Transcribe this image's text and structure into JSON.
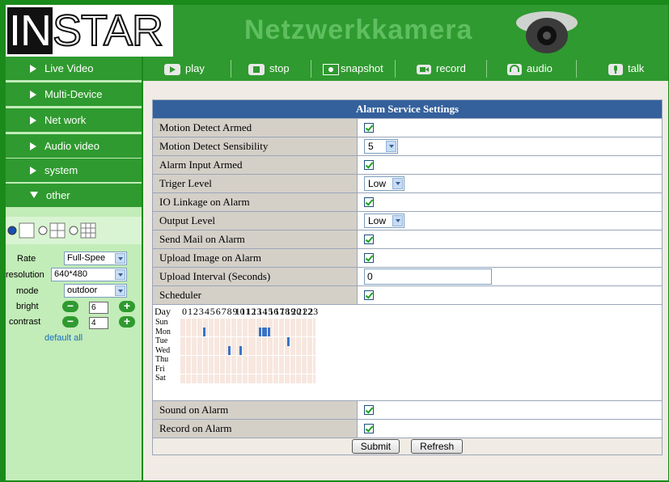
{
  "header": {
    "logo_text": "INSTAR",
    "logo_part1": "IN",
    "logo_part2": "STAR",
    "title": "Netzwerkkamera"
  },
  "sidebar": {
    "items": [
      {
        "label": "Live Video",
        "expanded": false
      },
      {
        "label": "Multi-Device",
        "expanded": false
      },
      {
        "label": "Net work",
        "expanded": false
      },
      {
        "label": "Audio video",
        "expanded": false
      },
      {
        "label": "system",
        "expanded": false
      },
      {
        "label": "other",
        "expanded": true
      }
    ],
    "controls": {
      "rate_label": "Rate",
      "rate_value": "Full-Spee",
      "resolution_label": "resolution",
      "resolution_value": "640*480",
      "mode_label": "mode",
      "mode_value": "outdoor",
      "bright_label": "bright",
      "bright_value": "6",
      "contrast_label": "contrast",
      "contrast_value": "4",
      "minus": "−",
      "plus": "+",
      "default_all": "default all"
    }
  },
  "toolbar": [
    {
      "label": "play",
      "icon": "play-icon"
    },
    {
      "label": "stop",
      "icon": "stop-icon"
    },
    {
      "label": "snapshot",
      "icon": "camera-icon"
    },
    {
      "label": "record",
      "icon": "video-camera-icon"
    },
    {
      "label": "audio",
      "icon": "headphones-icon"
    },
    {
      "label": "talk",
      "icon": "microphone-icon"
    }
  ],
  "alarm": {
    "title": "Alarm Service Settings",
    "rows": [
      {
        "label": "Motion Detect Armed",
        "type": "checkbox",
        "checked": true
      },
      {
        "label": "Motion Detect Sensibility",
        "type": "select",
        "value": "5"
      },
      {
        "label": "Alarm Input Armed",
        "type": "checkbox",
        "checked": true
      },
      {
        "label": "Triger Level",
        "type": "select",
        "value": "Low"
      },
      {
        "label": "IO Linkage on Alarm",
        "type": "checkbox",
        "checked": true
      },
      {
        "label": "Output Level",
        "type": "select",
        "value": "Low"
      },
      {
        "label": "Send Mail on Alarm",
        "type": "checkbox",
        "checked": true
      },
      {
        "label": "Upload Image on Alarm",
        "type": "checkbox",
        "checked": true
      },
      {
        "label": "Upload Interval (Seconds)",
        "type": "text",
        "value": "0"
      },
      {
        "label": "Scheduler",
        "type": "checkbox",
        "checked": true
      }
    ],
    "after_rows": [
      {
        "label": "Sound on Alarm",
        "type": "checkbox",
        "checked": true
      },
      {
        "label": "Record on Alarm",
        "type": "checkbox",
        "checked": true
      }
    ],
    "scheduler": {
      "day_header": "Day",
      "hours": [
        "0",
        "1",
        "2",
        "3",
        "4",
        "5",
        "6",
        "7",
        "8",
        "9",
        "10",
        "11",
        "12",
        "13",
        "14",
        "15",
        "16",
        "17",
        "18",
        "19",
        "20",
        "21",
        "22",
        "23"
      ],
      "days": [
        "Sun",
        "Mon",
        "Tue",
        "Wed",
        "Thu",
        "Fri",
        "Sat"
      ],
      "active_slots": {
        "Mon": [
          8,
          28,
          29,
          30,
          31
        ],
        "Tue": [
          38
        ],
        "Wed": [
          17,
          21
        ]
      }
    },
    "submit_label": "Submit",
    "refresh_label": "Refresh"
  },
  "colors": {
    "brand_green": "#2f9a2f",
    "sidebar_bg": "#c2ecb8",
    "title_blue": "#34609c",
    "slot_active": "#3a72c8",
    "slot_idle": "#f7e7df"
  }
}
